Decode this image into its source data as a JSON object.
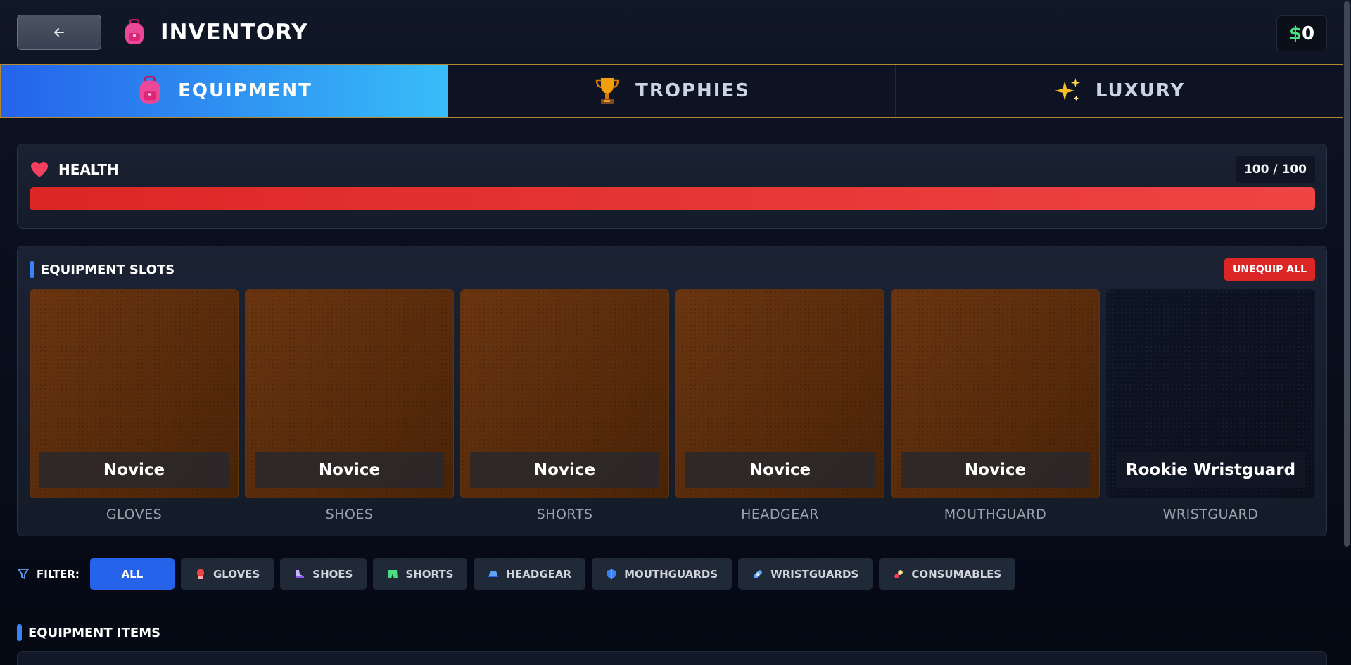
{
  "header": {
    "back_icon": "arrow-left-icon",
    "title": "INVENTORY",
    "title_icon": "backpack-icon",
    "money_symbol": "$",
    "money_amount": "0"
  },
  "tabs": [
    {
      "label": "EQUIPMENT",
      "icon": "backpack-icon",
      "active": true
    },
    {
      "label": "TROPHIES",
      "icon": "trophy-icon",
      "active": false
    },
    {
      "label": "LUXURY",
      "icon": "sparkles-icon",
      "active": false
    }
  ],
  "health": {
    "label": "HEALTH",
    "icon": "heart-icon",
    "value_text": "100 / 100",
    "current": 100,
    "max": 100
  },
  "slots": {
    "title": "EQUIPMENT SLOTS",
    "unequip_label": "UNEQUIP ALL",
    "items": [
      {
        "item": "Novice",
        "slot": "GLOVES"
      },
      {
        "item": "Novice",
        "slot": "SHOES"
      },
      {
        "item": "Novice",
        "slot": "SHORTS"
      },
      {
        "item": "Novice",
        "slot": "HEADGEAR"
      },
      {
        "item": "Novice",
        "slot": "MOUTHGUARD"
      },
      {
        "item": "Rookie Wristguard",
        "slot": "WRISTGUARD"
      }
    ]
  },
  "filter": {
    "label": "FILTER:",
    "chips": [
      {
        "label": "ALL",
        "icon": "",
        "active": true
      },
      {
        "label": "GLOVES",
        "icon": "boxing-glove-icon",
        "active": false
      },
      {
        "label": "SHOES",
        "icon": "shoe-icon",
        "active": false
      },
      {
        "label": "SHORTS",
        "icon": "shorts-icon",
        "active": false
      },
      {
        "label": "HEADGEAR",
        "icon": "cap-icon",
        "active": false
      },
      {
        "label": "MOUTHGUARDS",
        "icon": "shield-icon",
        "active": false
      },
      {
        "label": "WRISTGUARDS",
        "icon": "bandage-icon",
        "active": false
      },
      {
        "label": "CONSUMABLES",
        "icon": "pill-icon",
        "active": false
      }
    ]
  },
  "items_section": {
    "title": "EQUIPMENT ITEMS"
  },
  "colors": {
    "accent": "#2563eb",
    "tab_gradient_end": "#38bdf8",
    "health_bar": "#ef4444",
    "money_green": "#4ade80",
    "slot_equipped": "#6b3510",
    "danger": "#dc2626"
  }
}
